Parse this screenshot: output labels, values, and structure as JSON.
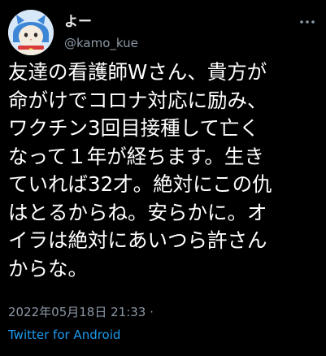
{
  "user": {
    "display_name": "よー",
    "handle": "@kamo_kue",
    "avatar_icon": "cat-in-blue-hood-avatar"
  },
  "tweet": {
    "lines": [
      "友達の看護師Wさん、貴方が",
      "命がけでコロナ対応に励み、",
      "ワクチン3回目接種して亡く",
      "なって１年が経ちます。生き",
      "ていれば32才。絶対にこの仇",
      "はとるからね。安らかに。オ",
      "イラは絶対にあいつら許さん",
      "からな。"
    ],
    "timestamp": "2022年05月18日 21:33 ·",
    "source": "Twitter for Android"
  },
  "colors": {
    "background": "#000000",
    "text": "#ffffff",
    "secondary": "#8b98a5",
    "link": "#1d9bf0"
  }
}
